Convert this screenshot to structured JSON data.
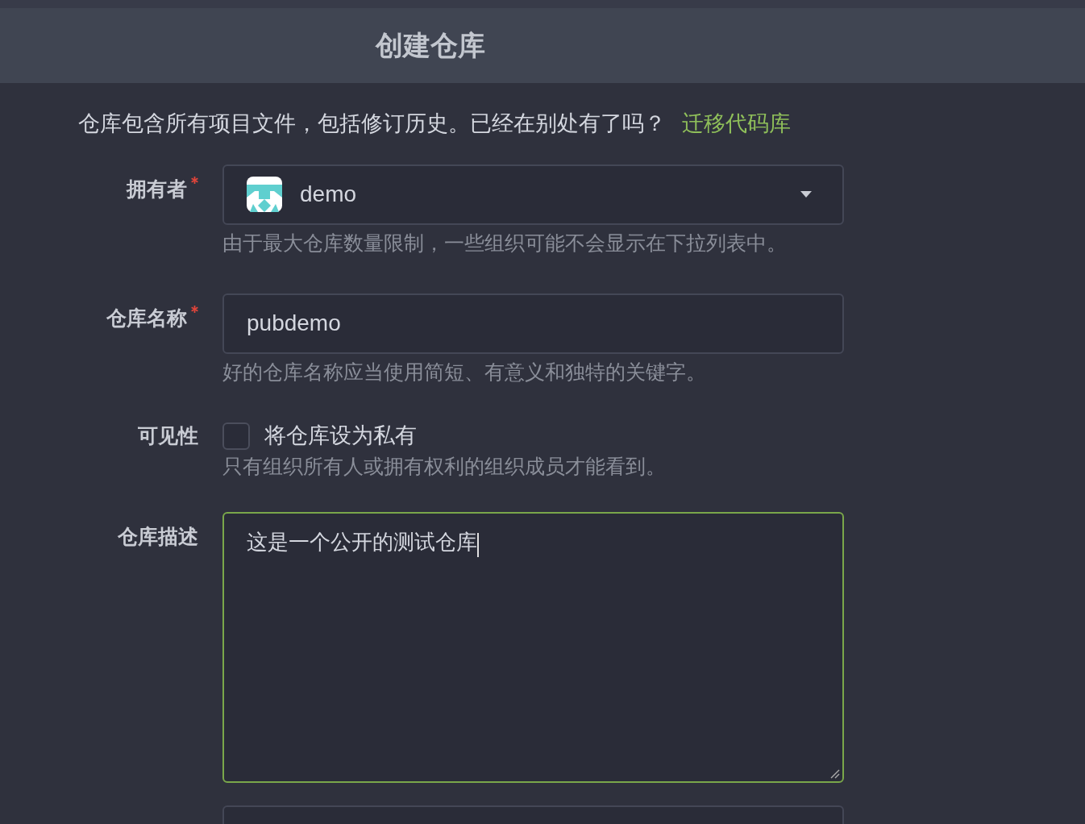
{
  "header": {
    "title": "创建仓库"
  },
  "intro": {
    "text": "仓库包含所有项目文件，包括修订历史。已经在别处有了吗？",
    "link": "迁移代码库"
  },
  "fields": [
    {
      "kind": "select",
      "label": "拥有者",
      "required": true,
      "value": "demo",
      "help": "由于最大仓库数量限制，一些组织可能不会显示在下拉列表中。"
    },
    {
      "kind": "input",
      "label": "仓库名称",
      "required": true,
      "value": "pubdemo",
      "help": "好的仓库名称应当使用简短、有意义和独特的关键字。"
    },
    {
      "kind": "checkbox",
      "label": "可见性",
      "checked": false,
      "text": "将仓库设为私有",
      "help": "只有组织所有人或拥有权利的组织成员才能看到。"
    },
    {
      "kind": "textarea",
      "label": "仓库描述",
      "value": "这是一个公开的测试仓库",
      "focused": true
    },
    {
      "kind": "partial"
    }
  ]
}
